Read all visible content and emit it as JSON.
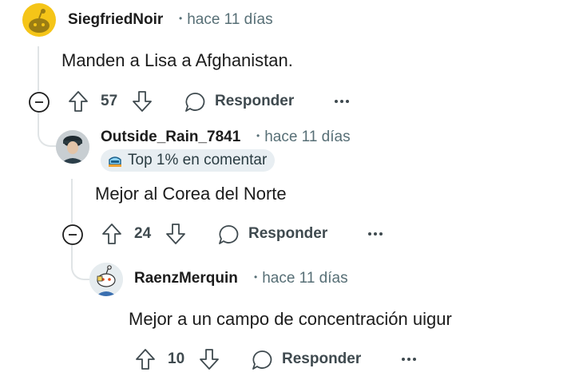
{
  "comments": [
    {
      "username": "SiegfriedNoir",
      "time": "hace 11 días",
      "body": "Manden a Lisa a Afghanistan.",
      "score": "57",
      "reply_label": "Responder"
    },
    {
      "username": "Outside_Rain_7841",
      "time": "hace 11 días",
      "badge": "Top 1% en comentar",
      "body": "Mejor al Corea del Norte",
      "score": "24",
      "reply_label": "Responder"
    },
    {
      "username": "RaenzMerquin",
      "time": "hace 11 días",
      "body": "Mejor a un campo de concentración uigur",
      "score": "10",
      "reply_label": "Responder"
    }
  ],
  "icons": {
    "upvote": "upvote-arrow-icon",
    "downvote": "downvote-arrow-icon",
    "reply": "speech-bubble-icon",
    "more": "ellipsis-icon",
    "collapse": "minus-circle-icon"
  },
  "colors": {
    "text": "#1c1c1c",
    "meta": "#576f76",
    "thread": "#e0e4e6",
    "avatar_yellow": "#f5c518"
  }
}
